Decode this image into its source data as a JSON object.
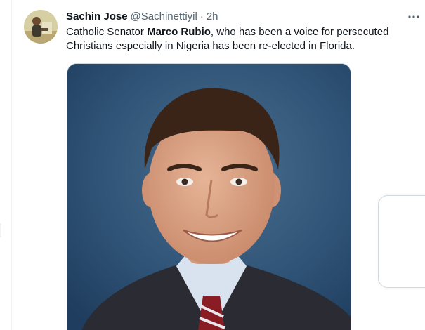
{
  "tweet": {
    "author_name": "Sachin Jose",
    "author_handle": "@Sachinettiyil",
    "separator": "·",
    "time": "2h",
    "more_icon": "more-horizontal-icon",
    "text_before": "Catholic Senator ",
    "text_bold": "Marco Rubio",
    "text_after": ", who has been a voice for persecuted Christians especially in Nigeria has been re-elected in Florida.",
    "media": {
      "type": "photo"
    }
  },
  "colors": {
    "primary_text": "#0f1419",
    "secondary_text": "#536471",
    "border": "#cfd9de",
    "photo_background": "#294a6e"
  }
}
